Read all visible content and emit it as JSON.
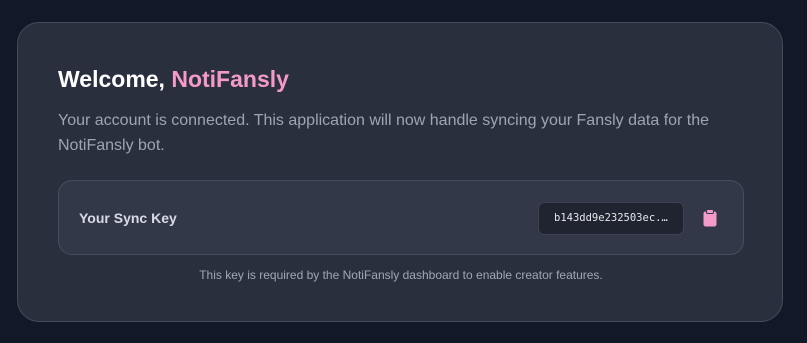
{
  "welcome": {
    "greeting": "Welcome, ",
    "brand_name": "NotiFansly",
    "brand_color": "#f49ac9"
  },
  "description": "Your account is connected. This application will now handle syncing your Fansly data for the NotiFansly bot.",
  "sync_key": {
    "label": "Your Sync Key",
    "value": "b143dd9e232503ec...",
    "copy_icon": "clipboard-icon"
  },
  "note": "This key is required by the NotiFansly dashboard to enable creator features."
}
